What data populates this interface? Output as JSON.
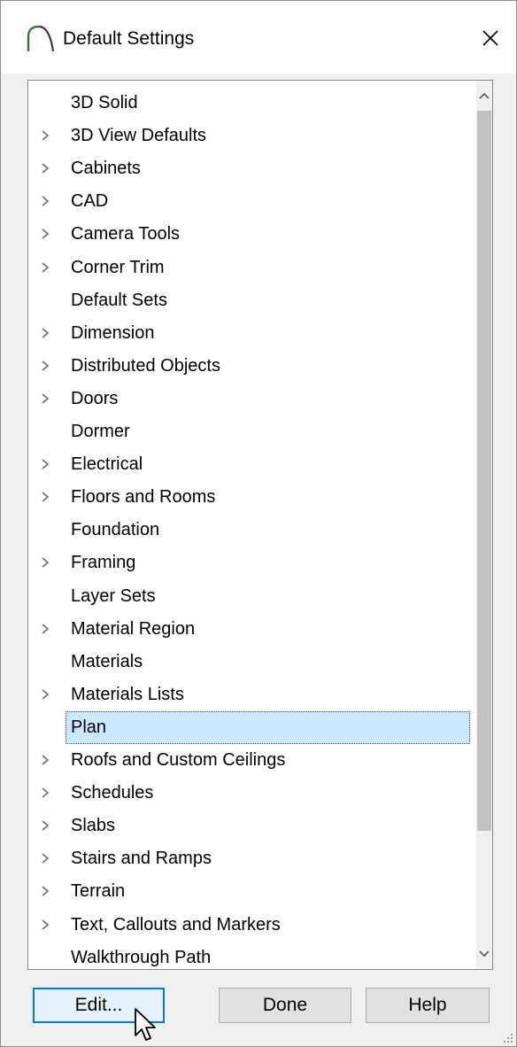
{
  "window": {
    "title": "Default Settings",
    "close_glyph": "×"
  },
  "tree": {
    "selected_index": 19,
    "items": [
      {
        "label": "3D Solid",
        "expandable": false
      },
      {
        "label": "3D View Defaults",
        "expandable": true
      },
      {
        "label": "Cabinets",
        "expandable": true
      },
      {
        "label": "CAD",
        "expandable": true
      },
      {
        "label": "Camera Tools",
        "expandable": true
      },
      {
        "label": "Corner Trim",
        "expandable": true
      },
      {
        "label": "Default Sets",
        "expandable": false
      },
      {
        "label": "Dimension",
        "expandable": true
      },
      {
        "label": "Distributed Objects",
        "expandable": true
      },
      {
        "label": "Doors",
        "expandable": true
      },
      {
        "label": "Dormer",
        "expandable": false
      },
      {
        "label": "Electrical",
        "expandable": true
      },
      {
        "label": "Floors and Rooms",
        "expandable": true
      },
      {
        "label": "Foundation",
        "expandable": false
      },
      {
        "label": "Framing",
        "expandable": true
      },
      {
        "label": "Layer Sets",
        "expandable": false
      },
      {
        "label": "Material Region",
        "expandable": true
      },
      {
        "label": "Materials",
        "expandable": false
      },
      {
        "label": "Materials Lists",
        "expandable": true
      },
      {
        "label": "Plan",
        "expandable": false
      },
      {
        "label": "Roofs and Custom Ceilings",
        "expandable": true
      },
      {
        "label": "Schedules",
        "expandable": true
      },
      {
        "label": "Slabs",
        "expandable": true
      },
      {
        "label": "Stairs and Ramps",
        "expandable": true
      },
      {
        "label": "Terrain",
        "expandable": true
      },
      {
        "label": "Text, Callouts and Markers",
        "expandable": true
      },
      {
        "label": "Walkthrough Path",
        "expandable": false
      }
    ]
  },
  "buttons": {
    "edit": "Edit...",
    "done": "Done",
    "help": "Help"
  },
  "colors": {
    "selection_bg": "#cce8ff",
    "default_button_border": "#0078d7",
    "scroll_thumb": "#c1c1c1"
  },
  "icons": {
    "app": "arch-icon",
    "expand": "chevron-right-icon",
    "scroll_up": "chevron-up-icon",
    "scroll_down": "chevron-down-icon",
    "close": "close-icon",
    "cursor": "mouse-pointer-icon",
    "resize": "resize-grip-icon"
  }
}
